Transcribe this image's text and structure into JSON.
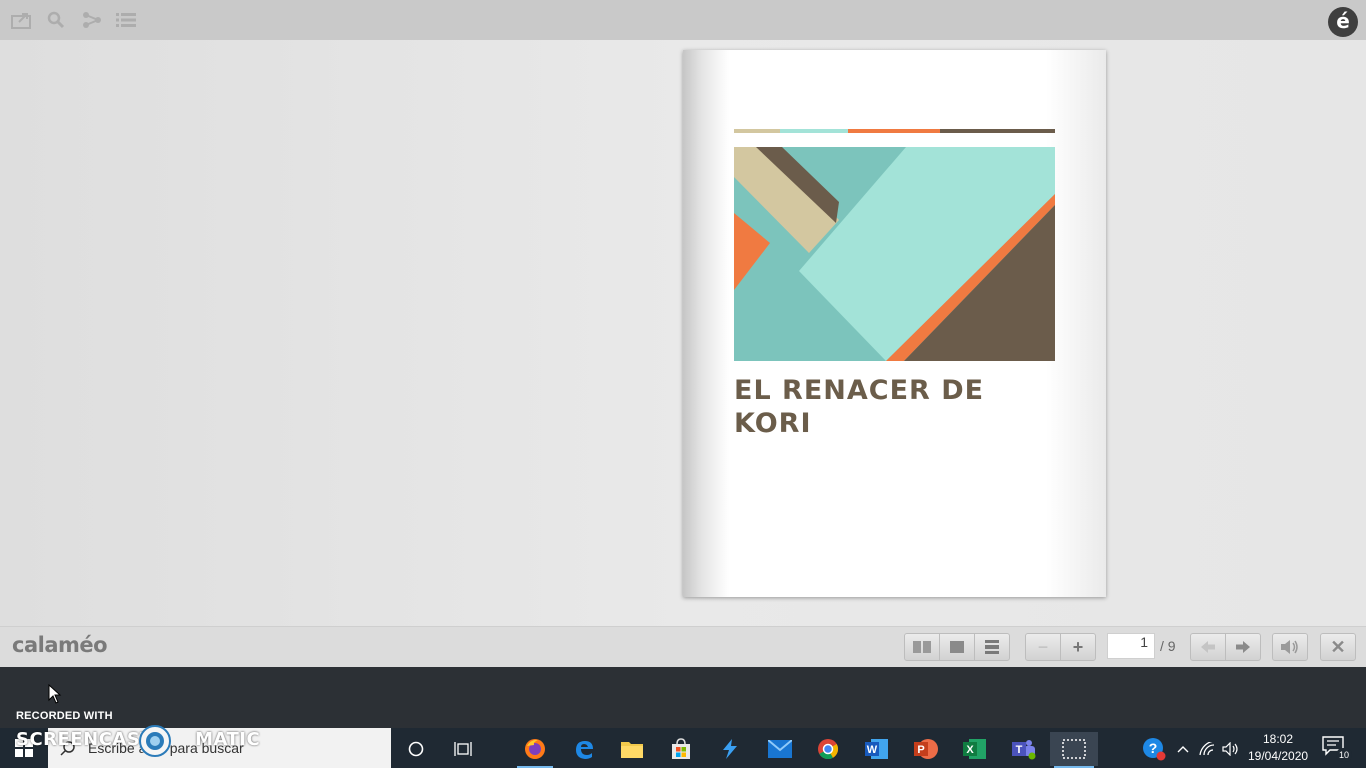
{
  "toolbar": {
    "icons": [
      "share-icon",
      "search-icon",
      "share-nodes-icon",
      "list-icon"
    ],
    "logo_letter": "é"
  },
  "document": {
    "title": "EL RENACER DE KORI",
    "title_line1": "EL RENACER DE",
    "title_line2": "KORI",
    "colors": {
      "tan": "#d3c7a0",
      "mint": "#a3e3d8",
      "teal": "#7cc4bc",
      "orange": "#f07a41",
      "brown": "#6b5c4b"
    }
  },
  "controls": {
    "brand": "calaméo",
    "current_page": "1",
    "total_pages": "/ 9",
    "view_modes": [
      "book-view-icon",
      "single-page-view-icon",
      "scroll-view-icon"
    ],
    "zoom_out": "−",
    "zoom_in": "+",
    "prev_icon": "arrow-left-icon",
    "next_icon": "arrow-right-icon",
    "sound_icon": "speaker-icon",
    "close": "✕"
  },
  "watermark": {
    "recorded_with": "RECORDED WITH",
    "brand_left": "SCREENCAST",
    "brand_right": "MATIC"
  },
  "taskbar": {
    "search_placeholder": "Escribe aquí para buscar",
    "apps": [
      "cortana",
      "task-view",
      "firefox",
      "edge",
      "file-explorer",
      "store",
      "azure",
      "mail",
      "chrome",
      "word",
      "powerpoint",
      "excel",
      "teams",
      "snipping-tool"
    ],
    "time": "18:02",
    "date": "19/04/2020",
    "notification_count": "10"
  }
}
